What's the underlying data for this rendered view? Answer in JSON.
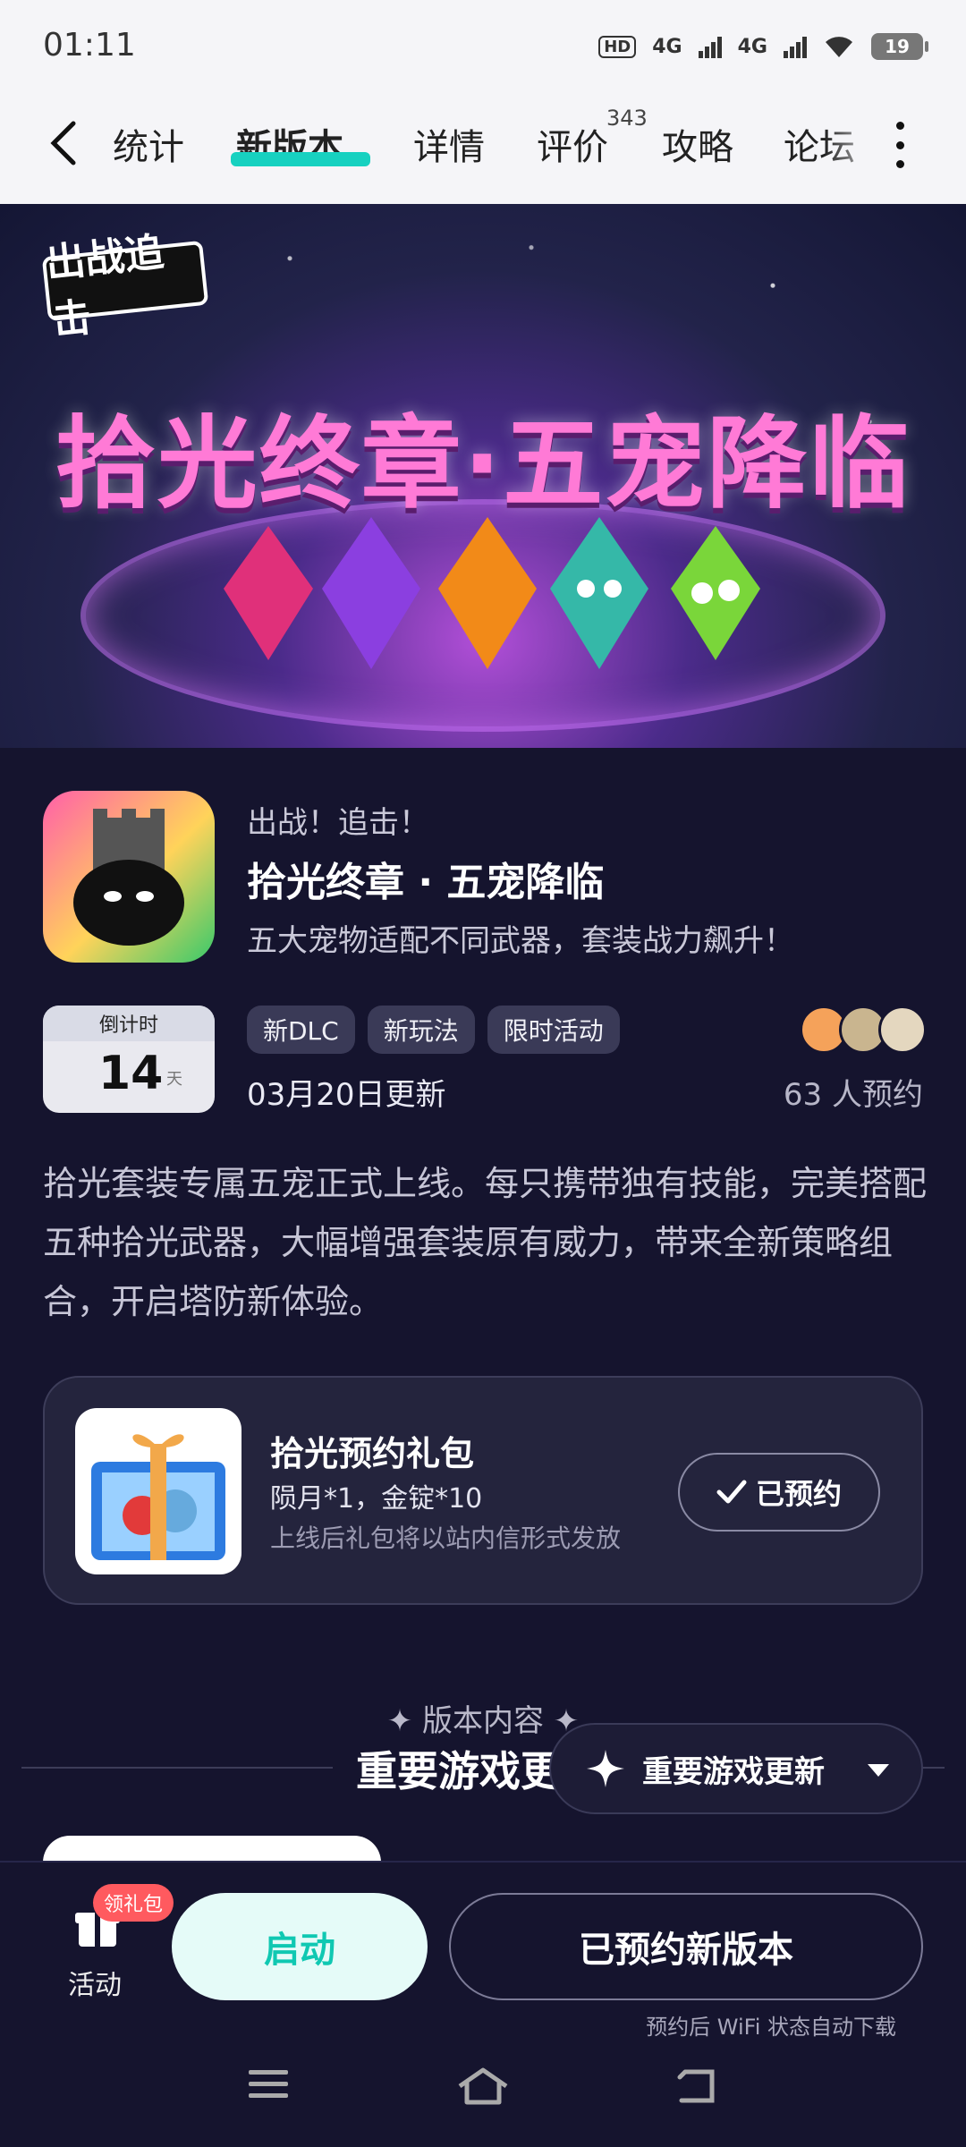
{
  "status": {
    "time": "01:11",
    "hd": "HD",
    "net1": "4G",
    "net2": "4G",
    "battery": "19"
  },
  "tabs": [
    {
      "label": "统计"
    },
    {
      "label": "新版本"
    },
    {
      "label": "详情"
    },
    {
      "label": "评价"
    },
    {
      "label": "攻略"
    },
    {
      "label": "论坛"
    }
  ],
  "review_count": "343",
  "banner": {
    "logo_text": "出战追击",
    "title": "拾光终章·五宠降临"
  },
  "app": {
    "name": "出战！追击！",
    "title": "拾光终章 · 五宠降临",
    "desc": "五大宠物适配不同武器，套装战力飙升！"
  },
  "countdown": {
    "label": "倒计时",
    "days": "14",
    "unit": "天"
  },
  "tags": [
    "新DLC",
    "新玩法",
    "限时活动"
  ],
  "update_date": "03月20日更新",
  "reservations": "63 人预约",
  "long_desc": "拾光套装专属五宠正式上线。每只携带独有技能，完美搭配五种拾光武器，大幅增强套装原有威力，带来全新策略组合，开启塔防新体验。",
  "gift_pack": {
    "title": "拾光预约礼包",
    "items": "陨月*1，金锭*10",
    "note": "上线后礼包将以站内信形式发放",
    "button": "已预约"
  },
  "section": {
    "sub": "✦ 版本内容 ✦",
    "title": "重要游戏更新",
    "dropdown": "重要游戏更新"
  },
  "bottom": {
    "activity_label": "活动",
    "gift_badge": "领礼包",
    "launch": "启动",
    "reserved_version": "已预约新版本",
    "wifi_note": "预约后 WiFi 状态自动下载"
  },
  "colors": {
    "accent": "#17d1c0",
    "bg": "#15142e",
    "badge": "#ff5a5f"
  }
}
